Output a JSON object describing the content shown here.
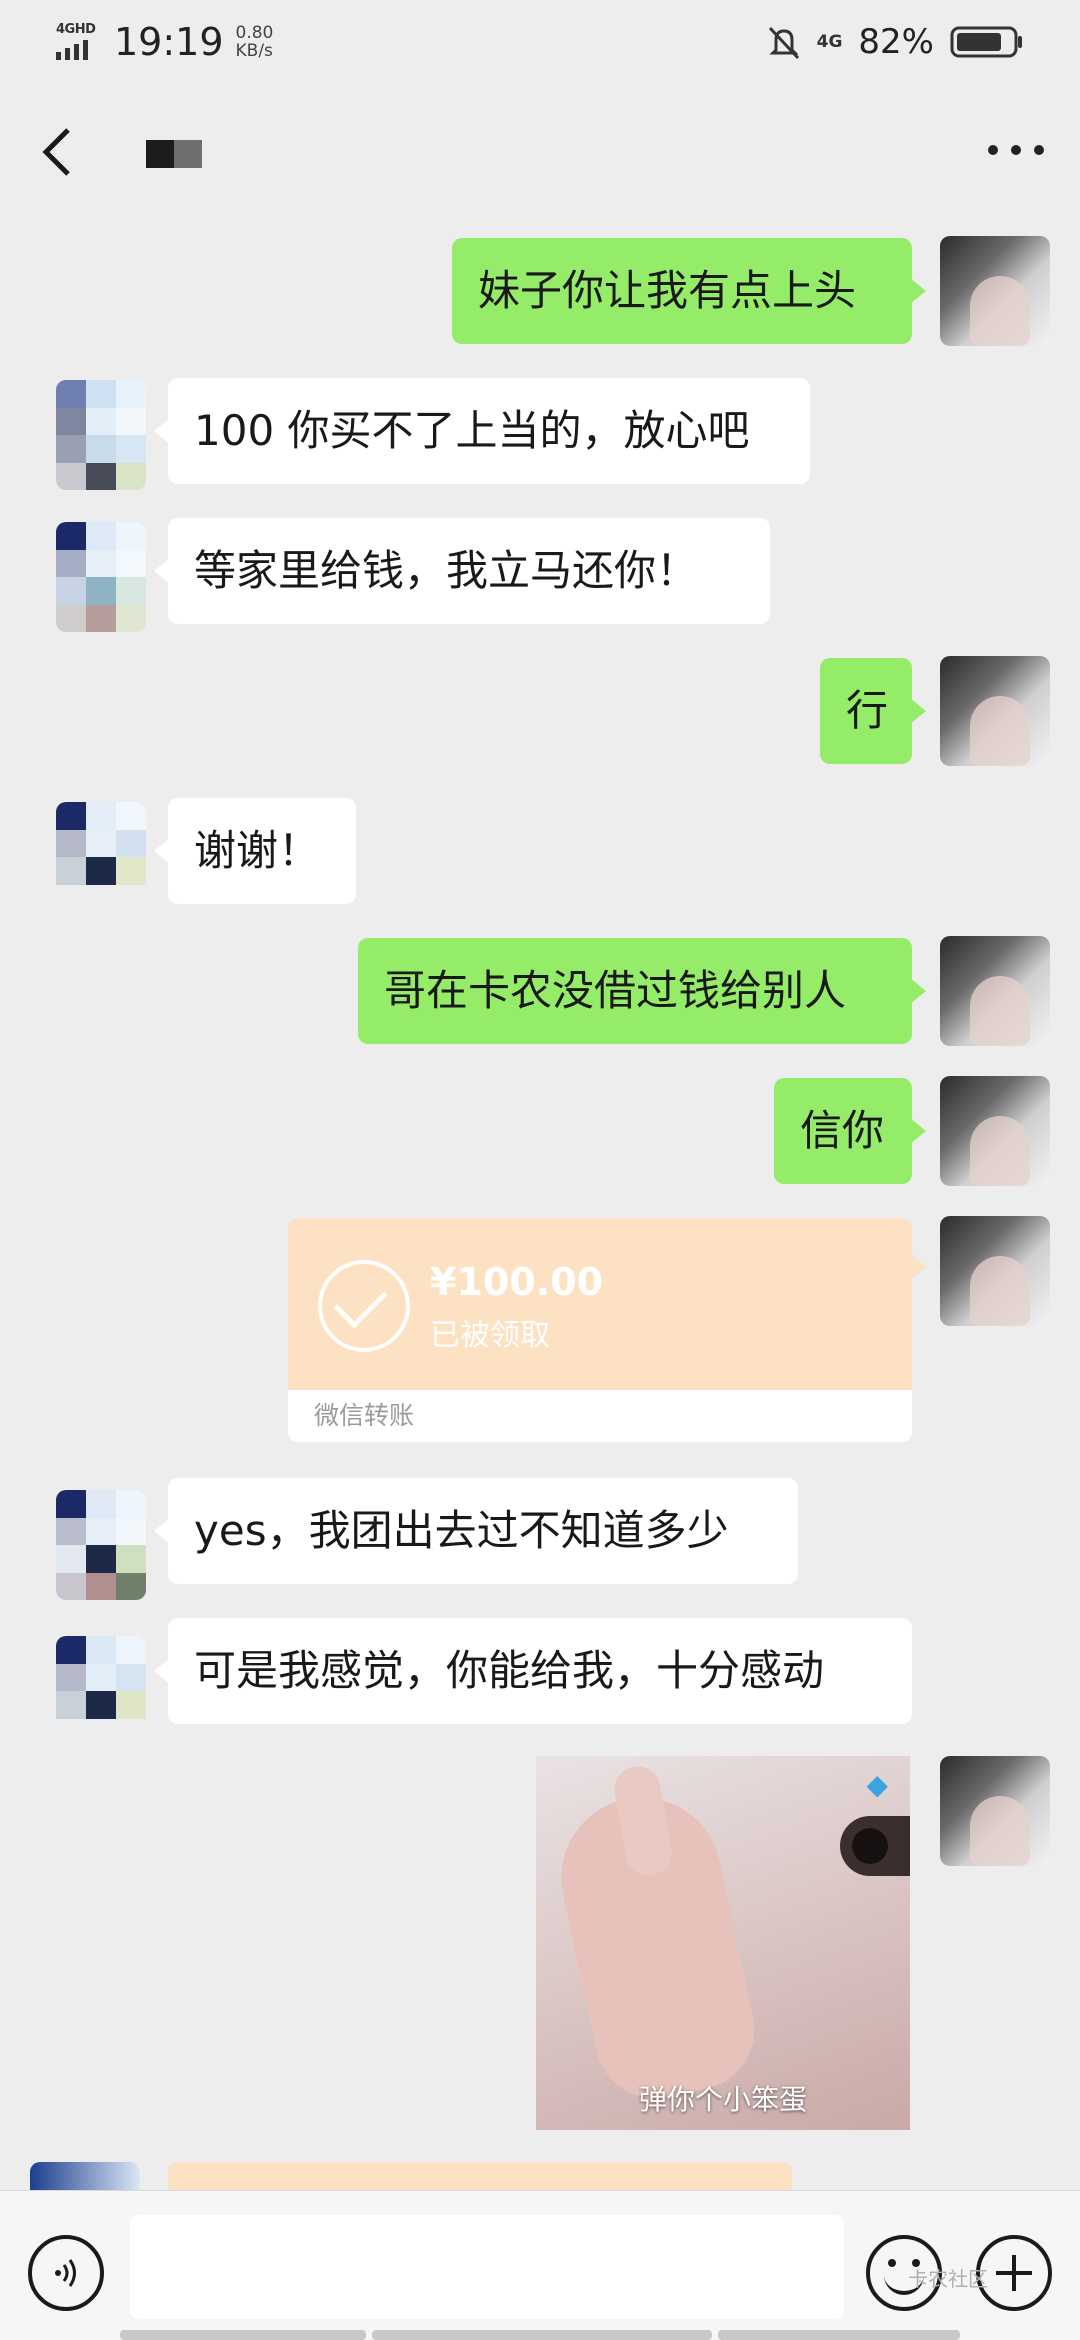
{
  "status_bar": {
    "network_label": "4GHD",
    "time": "19:19",
    "speed_value": "0.80",
    "speed_unit": "KB/s",
    "network_right": "4G",
    "battery_pct": "82%",
    "battery_level": 0.82
  },
  "nav": {
    "back_icon": "chevron-left-icon",
    "more_icon": "more-dots-icon"
  },
  "messages": [
    {
      "side": "out",
      "text": "妹子你让我有点上头"
    },
    {
      "side": "in",
      "text": "100 你买不了上当的，放心吧"
    },
    {
      "side": "in",
      "text": "等家里给钱，我立马还你！"
    },
    {
      "side": "out",
      "text": "行"
    },
    {
      "side": "in",
      "text": "谢谢！"
    },
    {
      "side": "out",
      "text": "哥在卡农没借过钱给别人"
    },
    {
      "side": "out",
      "text": "信你"
    },
    {
      "side": "in",
      "text": "yes，我团出去过不知道多少"
    },
    {
      "side": "in",
      "text": "可是我感觉，你能给我，十分感动"
    }
  ],
  "transfer": {
    "amount": "¥100.00",
    "status": "已被领取",
    "footer": "微信转账"
  },
  "sticker": {
    "caption": "弹你个小笨蛋"
  },
  "input": {
    "value": "",
    "voice_icon": "voice-icon",
    "emoji_icon": "emoji-icon",
    "plus_icon": "plus-icon"
  },
  "watermark": "卡农社区",
  "colors": {
    "outgoing_bubble": "#95ec69",
    "incoming_bubble": "#ffffff",
    "transfer_bg": "#fde1c3",
    "chat_bg": "#ededed"
  }
}
